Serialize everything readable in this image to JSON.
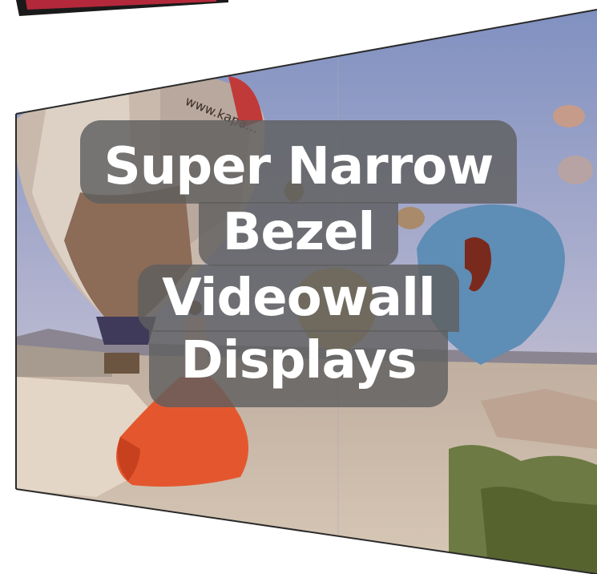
{
  "caption": {
    "line1": "Super Narrow",
    "line2": "Bezel",
    "line3": "Videowall",
    "line4": "Displays"
  },
  "balloon_print": "www.kapa...",
  "colors": {
    "sky_top": "#7e8fc0",
    "sky_bottom": "#d9cbd0",
    "ground": "#c9b7a6",
    "dress": "#e4572e",
    "overlay": "#5f5f5f",
    "caption_text": "#ffffff",
    "bezel_red": "#b3283a"
  }
}
